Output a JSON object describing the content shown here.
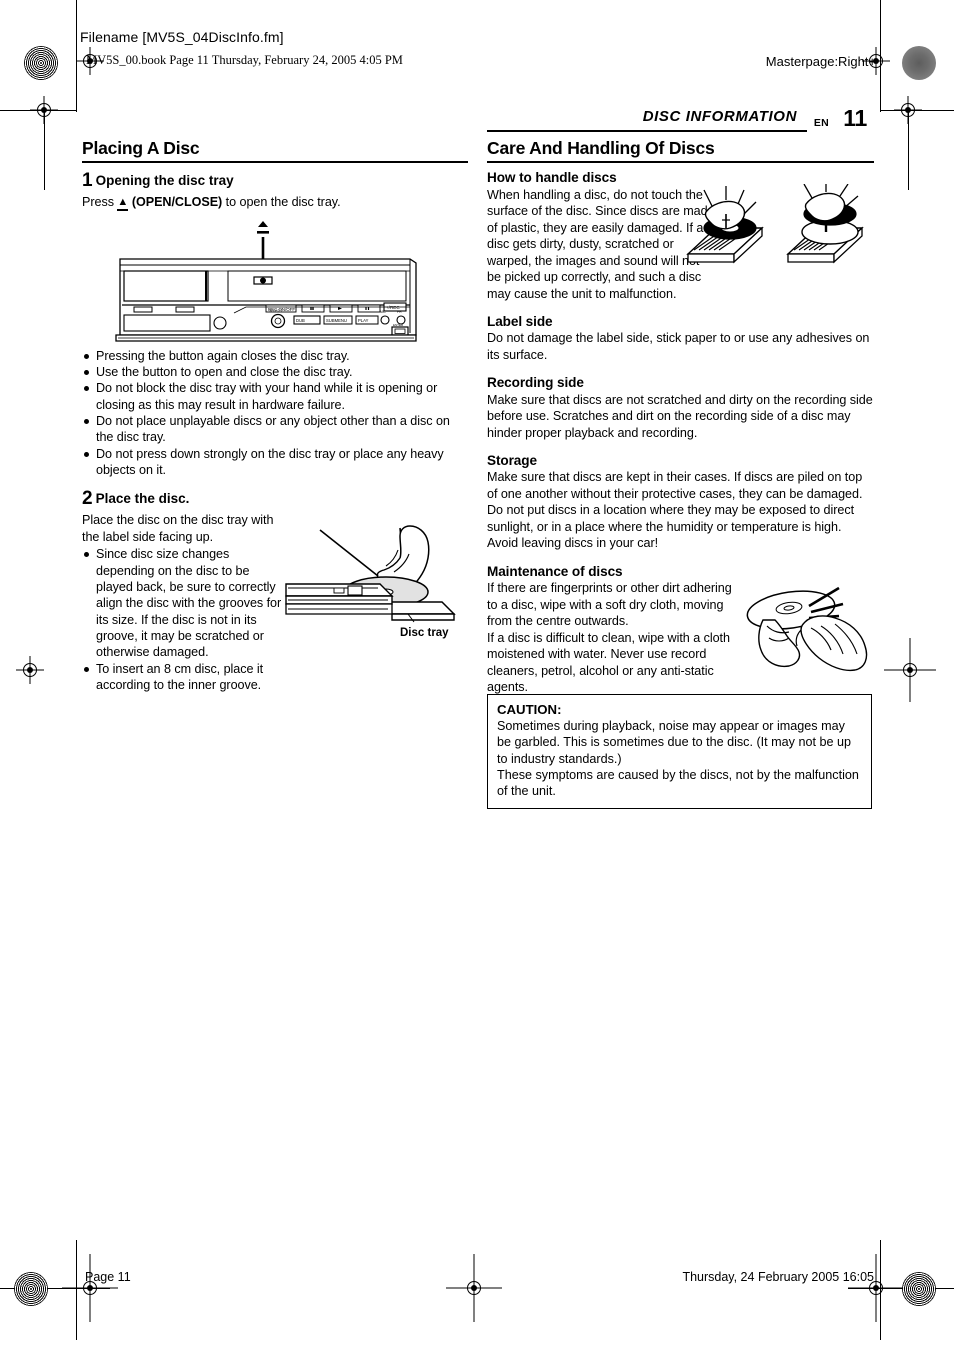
{
  "header": {
    "filename_label": "Filename [MV5S_04DiscInfo.fm]",
    "book_line": "MV5S_00.book  Page 11  Thursday, February 24, 2005  4:05 PM",
    "masterpage": "Masterpage:Right+"
  },
  "running_head": {
    "title": "DISC INFORMATION",
    "lang": "EN",
    "page_number": "11"
  },
  "left_column": {
    "section_title": "Placing A Disc",
    "step1": {
      "number": "1",
      "title": "Opening the disc tray",
      "body_prefix": "Press ",
      "eject_icon": "eject-icon",
      "body_bold": "(OPEN/CLOSE)",
      "body_suffix": " to open the disc tray.",
      "figure_name": "front-panel-illustration",
      "bullets": [
        "Pressing the button again closes the disc tray.",
        "Use the button to open and close the disc tray.",
        "Do not block the disc tray with your hand while it is opening or closing as this may result in hardware failure.",
        "Do not place unplayable discs or any object other than a disc on the disc tray.",
        "Do not press down strongly on the disc tray or place any heavy objects on it."
      ]
    },
    "step2": {
      "number": "2",
      "title": "Place the disc.",
      "body": "Place the disc on the disc tray with the label side facing up.",
      "bullets": [
        "Since disc size changes depending on the disc to be played back, be sure to correctly align the disc with the grooves for its size. If the disc is not in its groove, it may be scratched or otherwise damaged.",
        "To insert an 8 cm disc, place it according to the inner groove."
      ],
      "figure_name": "disc-tray-illustration",
      "figure_caption": "Disc tray"
    }
  },
  "right_column": {
    "section_title": "Care And Handling Of Discs",
    "subsections": [
      {
        "heading": "How to handle discs",
        "body": "When handling a disc, do not touch the surface of the disc. Since discs are made of plastic, they are easily damaged. If a disc gets dirty, dusty, scratched or warped, the images and sound will not be picked up correctly, and such a disc may cause the unit to malfunction.",
        "figure_name": "handling-discs-illustration"
      },
      {
        "heading": "Label side",
        "body": "Do not damage the label side, stick paper to or use any adhesives on its surface."
      },
      {
        "heading": "Recording side",
        "body": "Make sure that discs are not scratched and dirty on the recording side before use. Scratches and dirt on the recording side of a disc may hinder proper playback and recording."
      },
      {
        "heading": "Storage",
        "body": "Make sure that discs are kept in their cases. If discs are piled on top of one another without their protective cases, they can be damaged. Do not put discs in a location where they may be exposed to direct sunlight, or in a place where the humidity or temperature is high. Avoid leaving discs in your car!"
      },
      {
        "heading": "Maintenance of discs",
        "body_1": "If there are fingerprints or other dirt adhering to a disc, wipe with a soft dry cloth, moving from the centre outwards.",
        "body_2": "If a disc is difficult to clean, wipe with a cloth moistened with water. Never use record cleaners, petrol, alcohol or any anti-static agents.",
        "figure_name": "wiping-disc-illustration"
      }
    ],
    "caution": {
      "title": "CAUTION:",
      "paragraph_1": "Sometimes during playback, noise may appear or images may be garbled. This is sometimes due to the disc. (It may not be up to industry standards.)",
      "paragraph_2": "These symptoms are caused by the discs, not by the malfunction of the unit."
    }
  },
  "footer": {
    "page_label": "Page 11",
    "timestamp": "Thursday, 24 February 2005  16:05"
  },
  "colors": {
    "ink": "#000000",
    "paper": "#ffffff",
    "halftone": "#6d6d6d",
    "disc_fill": "#e2e2e2"
  }
}
